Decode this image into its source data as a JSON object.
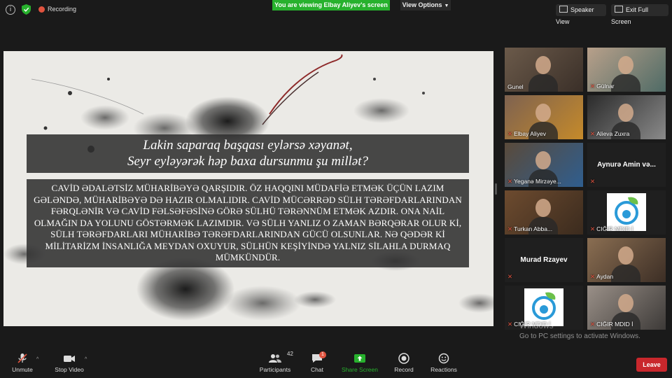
{
  "topbar": {
    "recording_label": "Recording",
    "viewing_banner": "You are viewing Elbay Aliyev's screen",
    "view_options_label": "View Options",
    "speaker_view_label": "Speaker View",
    "exit_full_screen_label": "Exit Full Screen"
  },
  "slide": {
    "poem_line1": "Lakin saparaq başqası eylərsə xəyanət,",
    "poem_line2": "Seyr eyləyərək həp baxa dursunmu şu millət?",
    "prose": "CAVİD ƏDALƏTSİZ MÜHARİBƏYƏ QARŞIDIR. ÖZ HAQQINI MÜDAFİƏ ETMƏK ÜÇÜN LAZIM GƏLƏNDƏ, MÜHARİBƏYƏ DƏ HAZIR OLMALIDIR. CAVİD MÜCƏRRƏD SÜLH TƏRƏFDARLARINDAN FƏRQLƏNİR VƏ CAVİD FƏLSƏFƏSİNƏ GÖRƏ SÜLHÜ TƏRƏNNÜM ETMƏK AZDIR. ONA NAİL OLMAĞIN DA YOLUNU GÖSTƏRMƏK LAZIMDIR. VƏ SÜLH YANLIZ O ZAMAN BƏRQƏRAR OLUR Kİ, SÜLH TƏRƏFDARLARI MÜHARİBƏ TƏRƏFDARLARINDAN GÜCÜ OLSUNLAR. NƏ QƏDƏR Kİ MİLİTARİZM İNSANLIĞA MEYDAN OXUYUR, SÜLHÜN KEŞİYİNDƏ YALNIZ SİLAHLA DURMAQ MÜMKÜNDÜR."
  },
  "participants": [
    {
      "name": "Gunel",
      "kind": "video",
      "muted": false,
      "active": true
    },
    {
      "name": "Gülnar",
      "kind": "video",
      "muted": true
    },
    {
      "name": "Elbay Aliyev",
      "kind": "video",
      "muted": true
    },
    {
      "name": "Alieva Zuxra",
      "kind": "video",
      "muted": true
    },
    {
      "name": "Yeganə Mirzəye...",
      "kind": "video",
      "muted": true
    },
    {
      "name": "Aynurə Amin və...",
      "kind": "name_only",
      "muted": true
    },
    {
      "name": "Turkan Abba...",
      "kind": "video",
      "muted": true
    },
    {
      "name": "CIĞIR MDID İ",
      "kind": "logo",
      "muted": true
    },
    {
      "name": "Murad Rzayev",
      "kind": "name_only",
      "muted": true
    },
    {
      "name": "Aydan",
      "kind": "video",
      "muted": true
    },
    {
      "name": "CIĞIR MDID İ",
      "kind": "logo",
      "muted": true
    },
    {
      "name": "CIĞIR MDID İ",
      "kind": "video",
      "muted": true
    }
  ],
  "toolbar": {
    "unmute_label": "Unmute",
    "stop_video_label": "Stop Video",
    "participants_label": "Participants",
    "participants_count": "42",
    "chat_label": "Chat",
    "chat_badge": "1",
    "share_screen_label": "Share Screen",
    "record_label": "Record",
    "reactions_label": "Reactions",
    "leave_label": "Leave"
  },
  "watermark": {
    "line1": "Windows",
    "line2": "Go to PC settings to activate Windows."
  },
  "colors": {
    "accent_green": "#27b12d",
    "leave_red": "#c9272c",
    "active_speaker": "#d6e44a"
  }
}
